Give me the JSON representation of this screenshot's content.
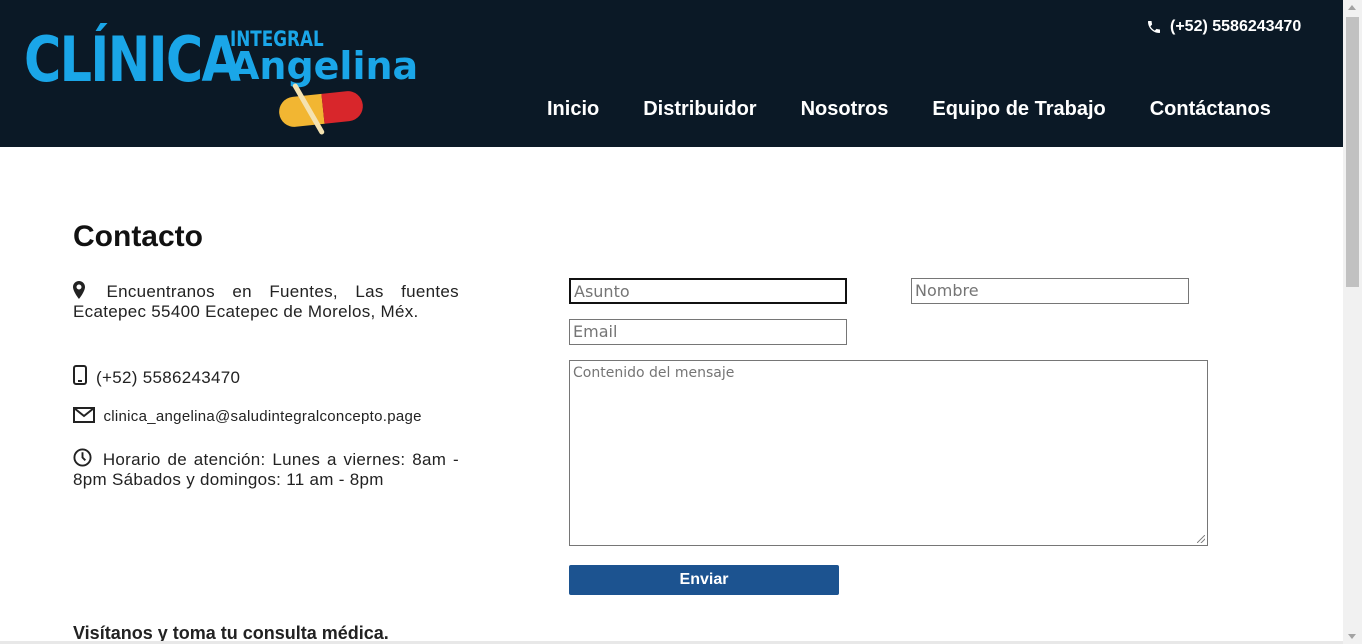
{
  "header": {
    "logo": {
      "line1": "CLÍNICA",
      "line2": "INTEGRAL",
      "line3": "Angelina"
    },
    "phone": "(+52) 5586243470",
    "nav": [
      "Inicio",
      "Distribuidor",
      "Nosotros",
      "Equipo de Trabajo",
      "Contáctanos"
    ]
  },
  "contact": {
    "title": "Contacto",
    "address": "Encuentranos en Fuentes, Las fuentes Ecatepec 55400 Ecatepec de Morelos, Méx.",
    "phone": "(+52) 5586243470",
    "email": "clinica_angelina@saludintegralconcepto.page",
    "hours": "Horario de atención: Lunes a viernes: 8am - 8pm Sábados y domingos: 11 am - 8pm"
  },
  "form": {
    "subject_placeholder": "Asunto",
    "name_placeholder": "Nombre",
    "email_placeholder": "Email",
    "message_placeholder": "Contenido del mensaje",
    "send_label": "Enviar"
  },
  "footer": {
    "visit_text": "Visítanos y toma tu consulta médica."
  },
  "colors": {
    "header_bg": "#0b1926",
    "logo_blue": "#1aa6e8",
    "button_blue": "#1c5390"
  }
}
